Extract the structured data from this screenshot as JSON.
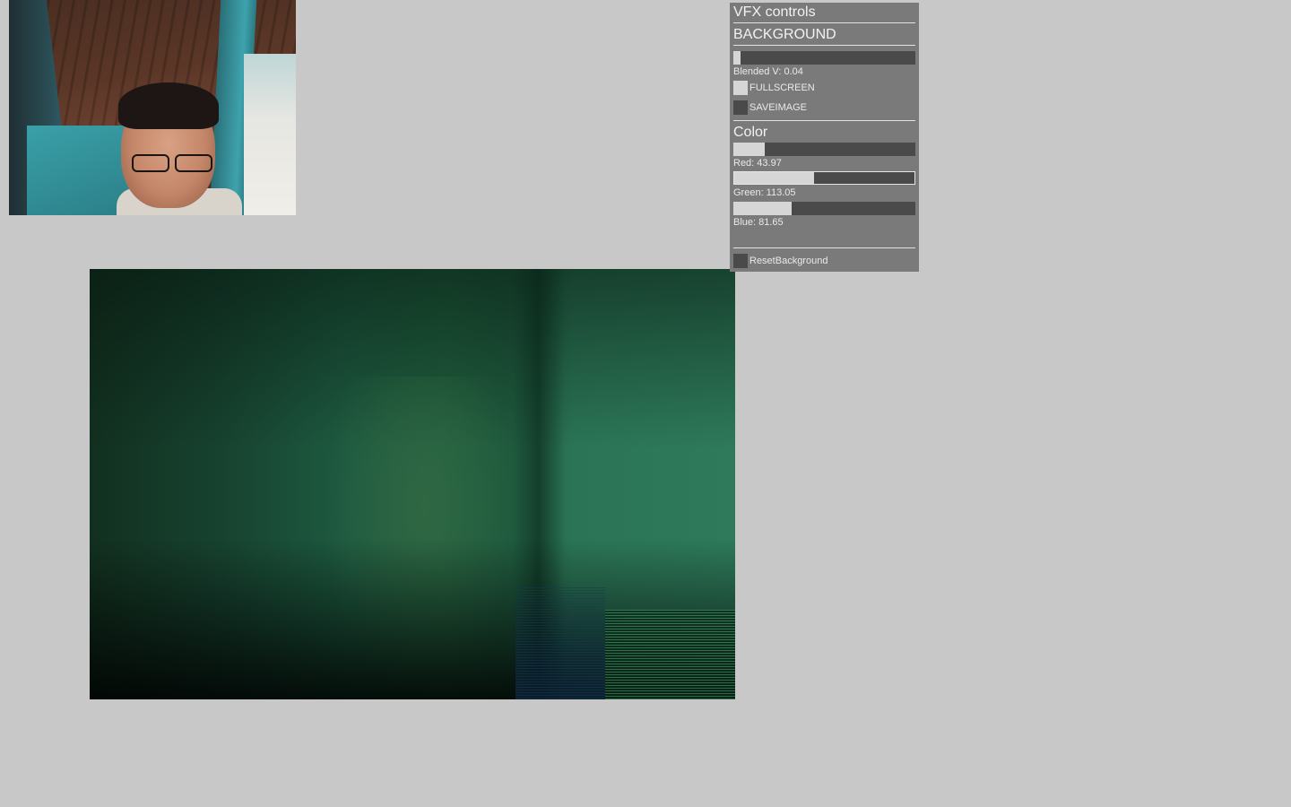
{
  "panel": {
    "title": "VFX controls",
    "background_section": {
      "title": "BACKGROUND",
      "blended_slider": {
        "label": "Blended V: 0.04",
        "value": 0.04,
        "min": 0,
        "max": 1
      },
      "fullscreen_toggle": {
        "label": "FULLSCREEN",
        "checked": true
      },
      "saveimage_toggle": {
        "label": "SAVEIMAGE",
        "checked": false
      }
    },
    "color_section": {
      "title": "Color",
      "red_slider": {
        "label": "Red: 43.97",
        "value": 43.97,
        "min": 0,
        "max": 255
      },
      "green_slider": {
        "label": "Green: 113.05",
        "value": 113.05,
        "min": 0,
        "max": 255
      },
      "blue_slider": {
        "label": "Blue: 81.65",
        "value": 81.65,
        "min": 0,
        "max": 255
      }
    },
    "reset_toggle": {
      "label": "ResetBackground",
      "checked": false
    }
  },
  "colors": {
    "app_background": "#c8c8c8",
    "panel_background": "#7a7a7a",
    "slider_track": "#4a4a4a",
    "slider_fill": "#d6d6d6",
    "panel_text": "#efefef",
    "tint": "#2c7152"
  }
}
